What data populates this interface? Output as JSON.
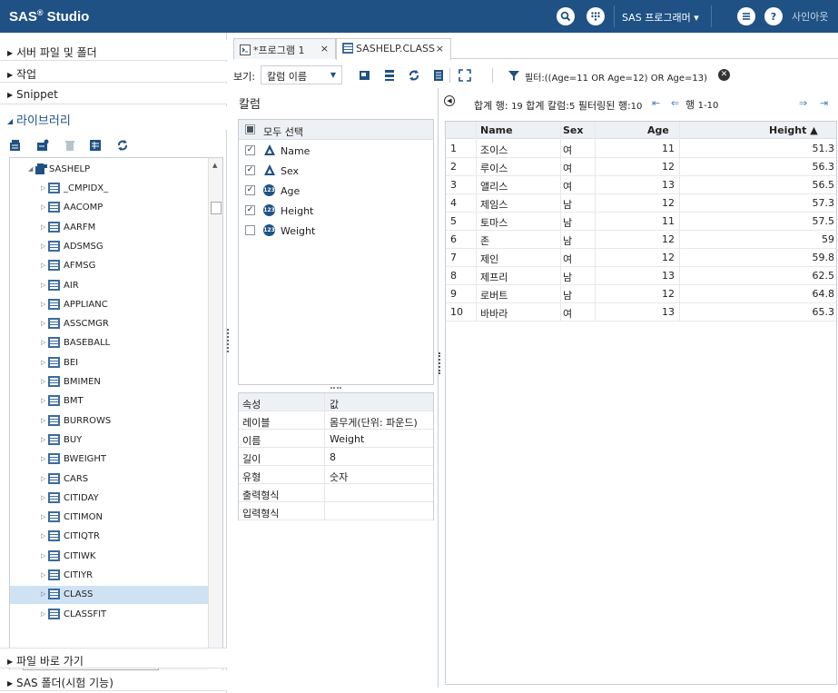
{
  "header": {
    "title": "SAS",
    "title_sup": "®",
    "title_rest": " Studio",
    "user_menu": "SAS 프로그래머 ▾",
    "signout": "사인아웃",
    "colors": {
      "bar": "#1f5185",
      "accent": "#4a80b8"
    },
    "icons": [
      "search-icon",
      "keypad-icon",
      "menu-icon",
      "help-icon"
    ]
  },
  "sidebar": {
    "sections": [
      {
        "label": "서버 파일 및 폴더",
        "expanded": false
      },
      {
        "label": "작업",
        "expanded": false
      },
      {
        "label": "Snippet",
        "expanded": false
      },
      {
        "label": "라이브러리",
        "expanded": true
      }
    ],
    "bottom_sections": [
      {
        "label": "파일 바로 가기"
      },
      {
        "label": "SAS 폴더(시험 기능)"
      }
    ],
    "library_root": "SASHELP",
    "tables": [
      "_CMPIDX_",
      "AACOMP",
      "AARFM",
      "ADSMSG",
      "AFMSG",
      "AIR",
      "APPLIANC",
      "ASSCMGR",
      "BASEBALL",
      "BEI",
      "BMIMEN",
      "BMT",
      "BURROWS",
      "BUY",
      "BWEIGHT",
      "CARS",
      "CITIDAY",
      "CITIMON",
      "CITIQTR",
      "CITIWK",
      "CITIYR",
      "CLASS",
      "CLASSFIT"
    ],
    "selected_table": "CLASS",
    "hscroll_grip": "III"
  },
  "tabs": [
    {
      "label": "*프로그램 1",
      "close": "×",
      "active": false
    },
    {
      "label": "SASHELP.CLASS",
      "close": "×",
      "active": true
    }
  ],
  "viewbar": {
    "view_label": "보기:",
    "view_value": "칼럼 이름",
    "filter_text": "필터:((Age=11 OR Age=12) OR Age=13)"
  },
  "columns_pane": {
    "title": "칼럼",
    "select_all": "모두 선택",
    "columns": [
      {
        "name": "Name",
        "type": "char",
        "checked": true
      },
      {
        "name": "Sex",
        "type": "char",
        "checked": true
      },
      {
        "name": "Age",
        "type": "num",
        "checked": true
      },
      {
        "name": "Height",
        "type": "num",
        "checked": true
      },
      {
        "name": "Weight",
        "type": "num",
        "checked": false
      }
    ],
    "num_badge": "123",
    "properties_header": {
      "key": "속성",
      "value": "값"
    },
    "properties": [
      {
        "key": "레이블",
        "value": "몸무게(단위: 파운드)"
      },
      {
        "key": "이름",
        "value": "Weight"
      },
      {
        "key": "길이",
        "value": "8"
      },
      {
        "key": "유형",
        "value": "숫자"
      },
      {
        "key": "출력형식",
        "value": ""
      },
      {
        "key": "입력형식",
        "value": ""
      }
    ]
  },
  "data_pane": {
    "summary_rows_label": "합계 행:",
    "summary_rows": "19",
    "summary_cols_label": "합계 칼럼:",
    "summary_cols": "5",
    "summary_filtered_label": "필터링된 행:",
    "summary_filtered": "10",
    "page_label": "행",
    "page_range": "1-10",
    "headers": {
      "name": "Name",
      "sex": "Sex",
      "age": "Age",
      "height": "Height ▲"
    },
    "rows": [
      {
        "n": "1",
        "name": "조이스",
        "sex": "여",
        "age": "11",
        "height": "51.3"
      },
      {
        "n": "2",
        "name": "루이스",
        "sex": "여",
        "age": "12",
        "height": "56.3"
      },
      {
        "n": "3",
        "name": "앨리스",
        "sex": "여",
        "age": "13",
        "height": "56.5"
      },
      {
        "n": "4",
        "name": "제임스",
        "sex": "남",
        "age": "12",
        "height": "57.3"
      },
      {
        "n": "5",
        "name": "토마스",
        "sex": "남",
        "age": "11",
        "height": "57.5"
      },
      {
        "n": "6",
        "name": "존",
        "sex": "남",
        "age": "12",
        "height": "59"
      },
      {
        "n": "7",
        "name": "제인",
        "sex": "여",
        "age": "12",
        "height": "59.8"
      },
      {
        "n": "8",
        "name": "제프리",
        "sex": "남",
        "age": "13",
        "height": "62.5"
      },
      {
        "n": "9",
        "name": "로버트",
        "sex": "남",
        "age": "12",
        "height": "64.8"
      },
      {
        "n": "10",
        "name": "바바라",
        "sex": "여",
        "age": "13",
        "height": "65.3"
      }
    ]
  }
}
